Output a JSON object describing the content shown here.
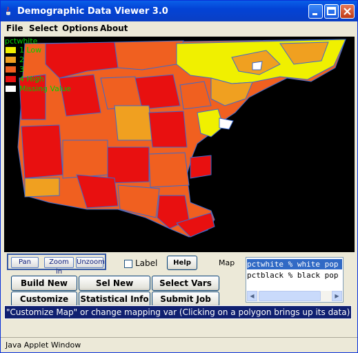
{
  "window": {
    "title": "Demographic Data Viewer 3.0",
    "title_icon": "java-cup-icon"
  },
  "menu": [
    "File",
    "Select",
    "Options",
    "About"
  ],
  "map": {
    "variable": "pctwhite",
    "legend": [
      {
        "label": "1  Low",
        "color": "#f0f000"
      },
      {
        "label": "2",
        "color": "#f0a020"
      },
      {
        "label": "3",
        "color": "#f06020"
      },
      {
        "label": "4  High",
        "color": "#e81010"
      },
      {
        "label": "Missing Value",
        "color": "#ffffff"
      }
    ]
  },
  "controls": {
    "pan": "Pan",
    "zoom_in": "Zoom in",
    "unzoom": "Unzoom",
    "label_checkbox": "Label",
    "help": "Help",
    "map_label": "Map",
    "buttons": [
      "Build New Vars",
      "Sel New Region",
      "Select Vars",
      "Customize Map",
      "Statistical Info",
      "Submit Job"
    ],
    "variables": [
      "pctwhite % white pop",
      "pctblack % black pop"
    ]
  },
  "status_text": "\"Customize Map\" or change mapping var (Clicking on a polygon brings up its data)",
  "footer_text": "Java Applet Window"
}
